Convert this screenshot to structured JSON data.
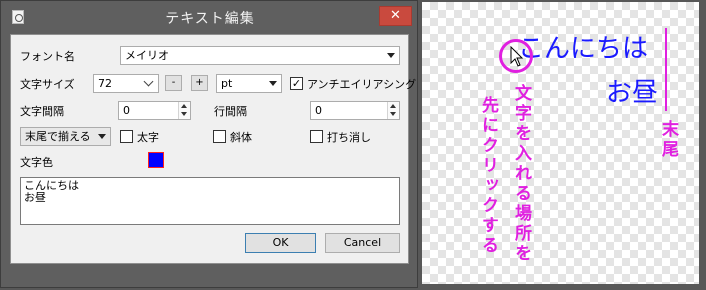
{
  "dialog": {
    "title": "テキスト編集",
    "close_label": "✕",
    "font_name_label": "フォント名",
    "font_name_value": "メイリオ",
    "size_label": "文字サイズ",
    "size_value": "72",
    "size_minus": "-",
    "size_plus": "+",
    "unit_value": "pt",
    "antialias_label": "アンチエイリアシング",
    "antialias_checked": true,
    "char_spacing_label": "文字間隔",
    "char_spacing_value": "0",
    "line_spacing_label": "行間隔",
    "line_spacing_value": "0",
    "align_value": "末尾で揃える",
    "bold_label": "太字",
    "italic_label": "斜体",
    "strike_label": "打ち消し",
    "color_label": "文字色",
    "text_color": "#0000ff",
    "text_value": "こんにちは\nお昼",
    "ok_label": "OK",
    "cancel_label": "Cancel"
  },
  "canvas": {
    "line1": "こんにちは",
    "line2": "お昼",
    "annotation_end": "末尾",
    "annotation_click1": "文字を入れる場所を",
    "annotation_click2": "先にクリックする",
    "text_color": "#1a1aff",
    "annotation_color": "#e020e0"
  }
}
